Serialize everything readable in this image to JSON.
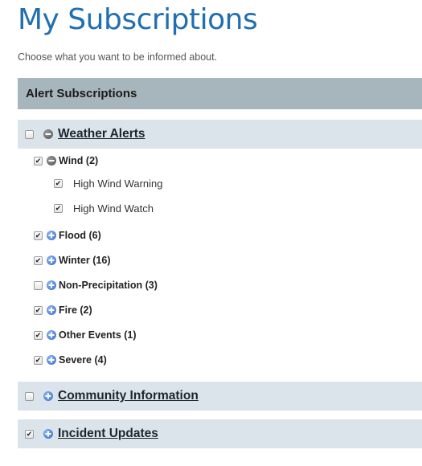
{
  "page": {
    "title": "My Subscriptions",
    "subtitle": "Choose what you want to be informed about."
  },
  "section": {
    "header": "Alert Subscriptions"
  },
  "groups": {
    "weather": {
      "label": "Weather Alerts",
      "checked": false,
      "expanded": true,
      "items": {
        "wind": {
          "label": "Wind (2)",
          "checked": true,
          "expanded": true,
          "children": {
            "high_wind_warning": {
              "label": "High Wind Warning",
              "checked": true
            },
            "high_wind_watch": {
              "label": "High Wind Watch",
              "checked": true
            }
          }
        },
        "flood": {
          "label": "Flood (6)",
          "checked": true,
          "expanded": false
        },
        "winter": {
          "label": "Winter (16)",
          "checked": true,
          "expanded": false
        },
        "non_precipitation": {
          "label": "Non-Precipitation (3)",
          "checked": false,
          "expanded": false
        },
        "fire": {
          "label": "Fire (2)",
          "checked": true,
          "expanded": false
        },
        "other_events": {
          "label": "Other Events (1)",
          "checked": true,
          "expanded": false
        },
        "severe": {
          "label": "Severe (4)",
          "checked": true,
          "expanded": false
        }
      }
    },
    "community": {
      "label": "Community Information",
      "checked": false,
      "expanded": false
    },
    "incident": {
      "label": "Incident Updates",
      "checked": true,
      "expanded": false
    }
  },
  "icons": {
    "expand": "plus-circle-icon",
    "collapse": "minus-circle-icon"
  },
  "colors": {
    "title": "#1f6fb2",
    "section_header_bg": "#a7b5bd",
    "group_bar_bg": "#dce4eb",
    "expand_icon": "#2f69c9",
    "collapse_icon": "#505050"
  }
}
